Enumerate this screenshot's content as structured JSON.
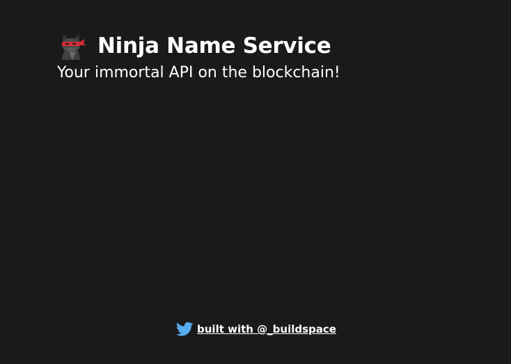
{
  "header": {
    "icon": "ninja-cat-icon",
    "title": "Ninja Name Service",
    "subtitle": "Your immortal API on the blockchain!"
  },
  "footer": {
    "icon": "twitter-icon",
    "link_text": "built with @_buildspace"
  },
  "colors": {
    "background": "#1a1a1a",
    "text": "#ffffff",
    "twitter_blue": "#55acee",
    "headband_red": "#d42a35"
  }
}
